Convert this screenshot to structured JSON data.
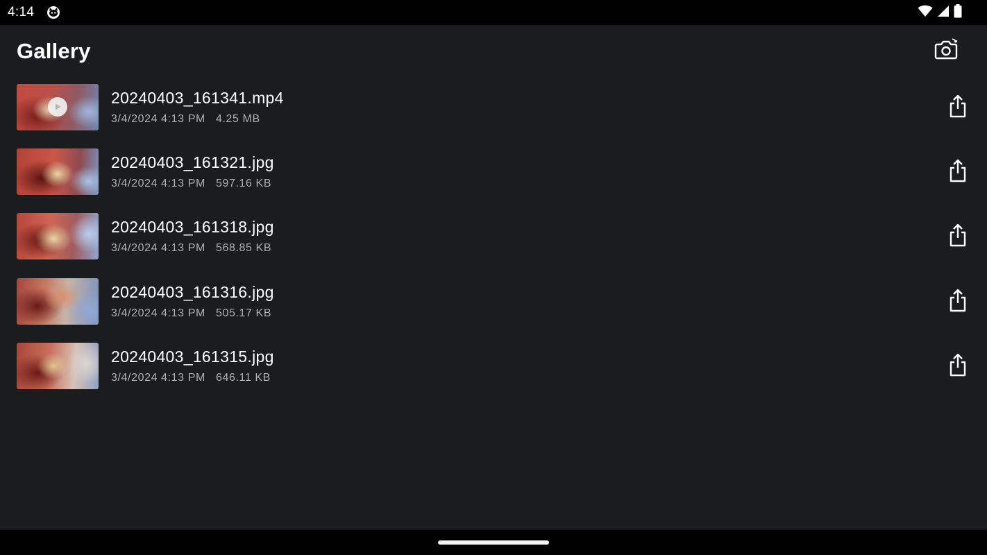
{
  "status_bar": {
    "time": "4:14",
    "app_icon": "cat-face-icon",
    "wifi_icon": "wifi-icon",
    "signal_icon": "cell-signal-icon",
    "battery_icon": "battery-icon"
  },
  "header": {
    "title": "Gallery",
    "camera_icon": "camera-switch-icon"
  },
  "files": [
    {
      "name": "20240403_161341.mp4",
      "date": "3/4/2024 4:13 PM",
      "size": "4.25 MB",
      "is_video": true
    },
    {
      "name": "20240403_161321.jpg",
      "date": "3/4/2024 4:13 PM",
      "size": "597.16 KB",
      "is_video": false
    },
    {
      "name": "20240403_161318.jpg",
      "date": "3/4/2024 4:13 PM",
      "size": "568.85 KB",
      "is_video": false
    },
    {
      "name": "20240403_161316.jpg",
      "date": "3/4/2024 4:13 PM",
      "size": "505.17 KB",
      "is_video": false
    },
    {
      "name": "20240403_161315.jpg",
      "date": "3/4/2024 4:13 PM",
      "size": "646.11 KB",
      "is_video": false
    }
  ],
  "colors": {
    "background": "#1b1c1e",
    "bars": "#000000",
    "text_primary": "#ffffff",
    "text_secondary": "#aeb0b4"
  }
}
